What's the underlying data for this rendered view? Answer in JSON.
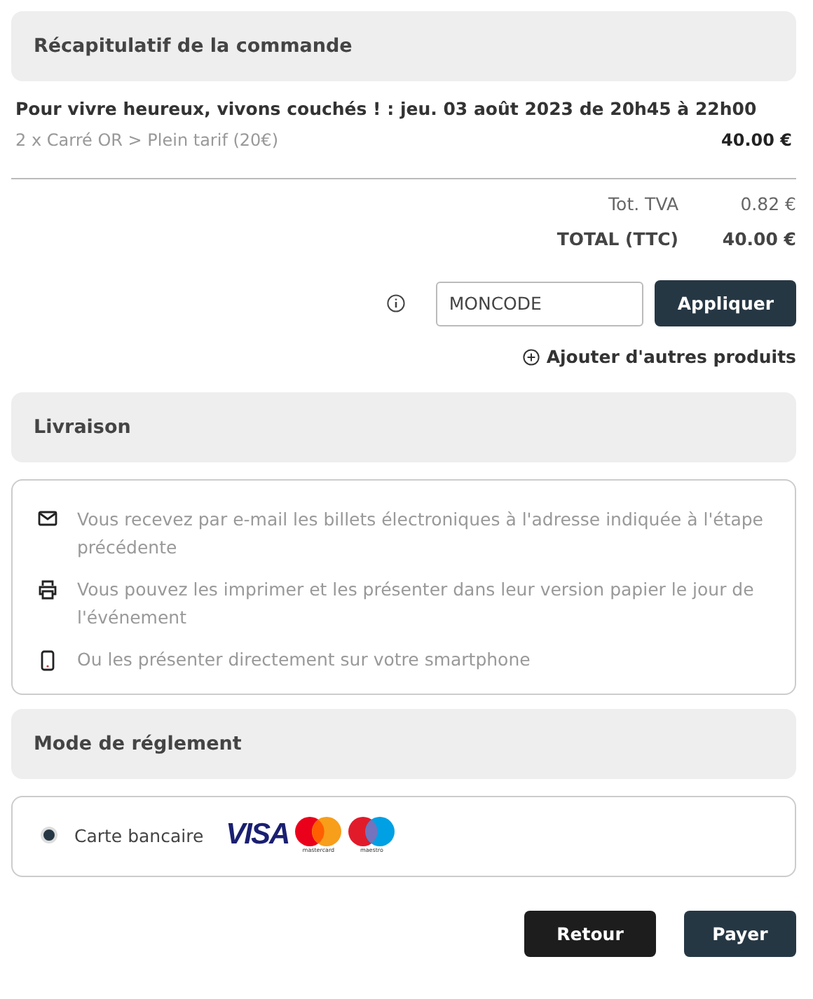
{
  "summary": {
    "title": "Récapitulatif de la commande",
    "event": "Pour vivre heureux, vivons couchés ! : jeu. 03 août 2023 de 20h45 à 22h00",
    "lines": [
      {
        "label": "2 x Carré OR > Plein tarif (20€)",
        "amount": "40.00 €"
      }
    ],
    "totals": [
      {
        "kind": "tax",
        "label": "Tot. TVA",
        "amount": "0.82 €"
      },
      {
        "kind": "total",
        "label": "TOTAL (TTC)",
        "amount": "40.00 €"
      }
    ],
    "promo": {
      "value": "MONCODE",
      "button": "Appliquer"
    },
    "add_products": "Ajouter d'autres produits"
  },
  "delivery": {
    "title": "Livraison",
    "items": [
      {
        "kind": "email",
        "text": "Vous recevez par e-mail les billets électroniques à l'adresse indiquée à l'étape précédente"
      },
      {
        "kind": "print",
        "text": "Vous pouvez les imprimer et les présenter dans leur version papier le jour de l'événement"
      },
      {
        "kind": "phone",
        "text": "Ou les présenter directement sur votre smartphone"
      }
    ]
  },
  "payment": {
    "title": "Mode de réglement",
    "options": [
      {
        "label": "Carte bancaire",
        "selected": true,
        "brands": [
          {
            "kind": "visa",
            "label": "VISA"
          },
          {
            "kind": "mastercard",
            "label": "mastercard"
          },
          {
            "kind": "maestro",
            "label": "maestro"
          }
        ]
      }
    ]
  },
  "buttons": [
    {
      "kind": "back",
      "label": "Retour"
    },
    {
      "kind": "pay",
      "label": "Payer"
    }
  ]
}
